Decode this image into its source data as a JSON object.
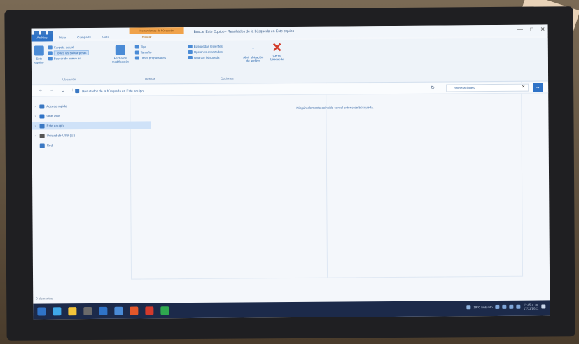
{
  "window": {
    "title": "Resultados de la búsqueda en Este equipo",
    "title_prefix": "Buscar Este Equipo",
    "context_tab": "Herramientas de búsqueda",
    "controls": [
      "—",
      "□",
      "✕"
    ]
  },
  "tabs": [
    {
      "label": "Archivo"
    },
    {
      "label": "Inicio"
    },
    {
      "label": "Compartir"
    },
    {
      "label": "Vista"
    },
    {
      "label": "Buscar"
    }
  ],
  "ribbon": {
    "location": {
      "big_label": "Este equipo",
      "items": [
        "Carpeta actual",
        "Todas las subcarpetas",
        "Buscar de nuevo en"
      ],
      "group_label": "Ubicación"
    },
    "refine": {
      "big_label": "Fecha de modificación",
      "items": [
        "Tipo",
        "Tamaño",
        "Otras propiedades"
      ],
      "group_label": "Refinar"
    },
    "options": {
      "items": [
        "Búsquedas recientes",
        "Opciones avanzadas",
        "Guardar búsqueda"
      ],
      "open_location": "Abrir ubicación de archivo",
      "close_search": "Cerrar búsqueda",
      "group_label": "Opciones"
    }
  },
  "address": {
    "path": "Resultados de la búsqueda en Este equipo",
    "search_value": "deliberaciones",
    "nav_back": "←",
    "nav_forward": "→",
    "nav_down": "⌄",
    "nav_up": "↑",
    "refresh": "↻",
    "go": "→"
  },
  "tree": [
    {
      "label": "Acceso rápido"
    },
    {
      "label": "OneDrive"
    },
    {
      "label": "Este equipo"
    },
    {
      "label": "Unidad de USB (E:)"
    },
    {
      "label": "Red"
    }
  ],
  "content": {
    "empty_message": "Ningún elemento coincide con el criterio de búsqueda."
  },
  "status": {
    "items": "0 elementos"
  },
  "taskbar": {
    "weather": "19°C Nublado",
    "time": "11:45 a. m.",
    "date": "17/11/2021",
    "apps_colors": [
      "#2f73c7",
      "#3fa8e8",
      "#f2c43a",
      "#6a6a6a",
      "#2f73c7",
      "#4a8bd6",
      "#e2572a",
      "#d33a2c",
      "#2fa84f"
    ]
  }
}
